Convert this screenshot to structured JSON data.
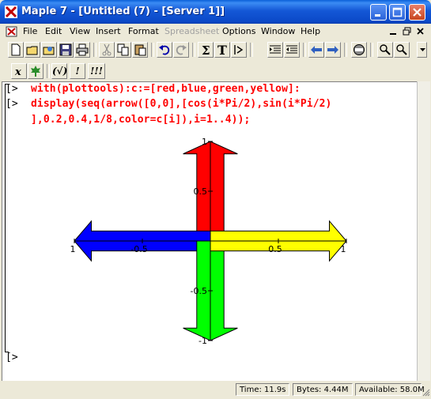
{
  "window": {
    "title": "Maple 7  - [Untitled (7) - [Server 1]]"
  },
  "menu": {
    "items": [
      "File",
      "Edit",
      "View",
      "Insert",
      "Format",
      "Spreadsheet",
      "Options",
      "Window",
      "Help"
    ],
    "disabled": [
      "Spreadsheet"
    ]
  },
  "toolbar2": {
    "eval_label": "(√)",
    "exec_label": "!",
    "exec_all_label": "!!!"
  },
  "worksheet": {
    "prompt_symbol": "[>",
    "input1": "with(plottools):c:=[red,blue,green,yellow]:",
    "input2_line1": "display(seq(arrow([0,0],[cos(i*Pi/2),sin(i*Pi/2)",
    "input2_line2": "],0.2,0.4,1/8,color=c[i]),i=1..4));",
    "empty_prompt": "[>"
  },
  "chart_data": {
    "type": "line",
    "title": "",
    "xlabel": "",
    "ylabel": "",
    "xlim": [
      -1,
      1
    ],
    "ylim": [
      -1,
      1
    ],
    "x_ticks": [
      "-1",
      "-0.5",
      "0.5",
      "1"
    ],
    "y_ticks": [
      "1",
      "0.5",
      "-0.5",
      "-1"
    ],
    "series": [
      {
        "color": "#ff0000",
        "from": [
          0,
          0
        ],
        "to": [
          0,
          1
        ]
      },
      {
        "color": "#0000ff",
        "from": [
          0,
          0
        ],
        "to": [
          -1,
          0
        ]
      },
      {
        "color": "#00ff00",
        "from": [
          0,
          0
        ],
        "to": [
          0,
          -1
        ]
      },
      {
        "color": "#ffff00",
        "from": [
          0,
          0
        ],
        "to": [
          1,
          0
        ]
      }
    ],
    "arrow_params": {
      "shaft_width": 0.2,
      "head_width": 0.4,
      "head_length_ratio": 0.125
    }
  },
  "status": {
    "time": "Time:  11.9s",
    "bytes": "Bytes: 4.44M",
    "available": "Available: 58.0M"
  }
}
